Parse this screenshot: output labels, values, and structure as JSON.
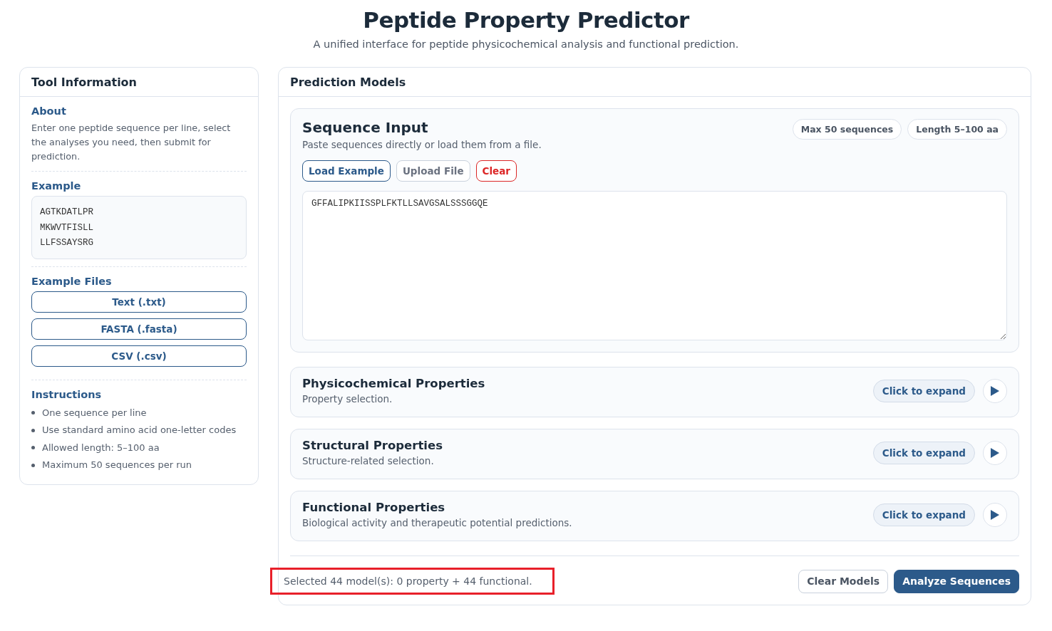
{
  "header": {
    "title": "Peptide Property Predictor",
    "subtitle": "A unified interface for peptide physicochemical analysis and functional prediction."
  },
  "sidebar": {
    "title": "Tool Information",
    "about": {
      "heading": "About",
      "text": "Enter one peptide sequence per line, select the analyses you need, then submit for prediction."
    },
    "example": {
      "heading": "Example",
      "lines": [
        "AGTKDATLPR",
        "MKWVTFISLL",
        "LLFSSAYSRG"
      ]
    },
    "example_files": {
      "heading": "Example Files",
      "buttons": [
        "Text (.txt)",
        "FASTA (.fasta)",
        "CSV (.csv)"
      ]
    },
    "instructions": {
      "heading": "Instructions",
      "items": [
        "One sequence per line",
        "Use standard amino acid one-letter codes",
        "Allowed length: 5–100 aa",
        "Maximum 50 sequences per run"
      ]
    }
  },
  "main": {
    "title": "Prediction Models",
    "sequence_input": {
      "title": "Sequence Input",
      "subtitle": "Paste sequences directly or load them from a file.",
      "badges": [
        "Max 50 sequences",
        "Length 5–100 aa"
      ],
      "buttons": [
        {
          "label": "Load Example",
          "kind": "primary"
        },
        {
          "label": "Upload File",
          "kind": "neutral"
        },
        {
          "label": "Clear",
          "kind": "danger"
        }
      ],
      "value": "GFFALIPKIISSPLFKTLLSAVGSALSSSGGQE"
    },
    "sections": [
      {
        "title": "Physicochemical Properties",
        "subtitle": "Property selection.",
        "toggle": "Click to expand",
        "expanded": false
      },
      {
        "title": "Structural Properties",
        "subtitle": "Structure-related selection.",
        "toggle": "Click to expand",
        "expanded": false
      },
      {
        "title": "Functional Properties",
        "subtitle": "Biological activity and therapeutic potential predictions.",
        "toggle": "Click to expand",
        "expanded": false
      }
    ],
    "footer": {
      "status": "Selected 44 model(s): 0 property + 44 functional.",
      "highlighted": true,
      "buttons": [
        {
          "label": "Clear Models",
          "kind": "secondary"
        },
        {
          "label": "Analyze Sequences",
          "kind": "primary"
        }
      ]
    }
  }
}
